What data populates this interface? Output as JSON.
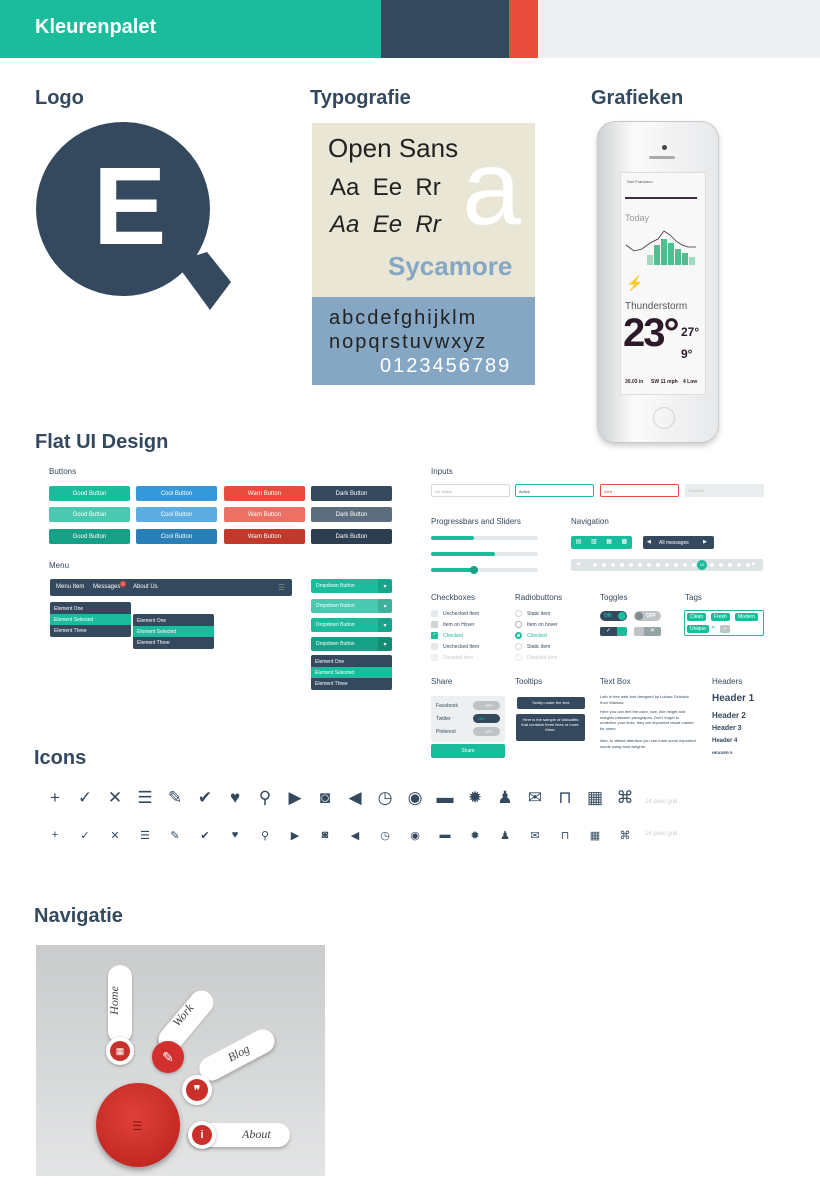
{
  "header": {
    "title": "Kleurenpalet",
    "colors": [
      "#1abc9c",
      "#34495e",
      "#e74c3c",
      "#ecf0f1"
    ]
  },
  "sections": {
    "logo": "Logo",
    "typografie": "Typografie",
    "grafieken": "Grafieken",
    "flat_ui": "Flat UI Design",
    "icons": "Icons",
    "navigatie": "Navigatie"
  },
  "logo": {
    "letter": "E"
  },
  "typography": {
    "font_name": "Open Sans",
    "sample_regular": "Aa  Ee  Rr",
    "sample_italic": "Aa  Ee  Rr",
    "big_letter": "a",
    "secondary_font": "Sycamore",
    "alphabet_1": "abcdefghijklm",
    "alphabet_2": "nopqrstuvwxyz",
    "digits": "0123456789"
  },
  "phone": {
    "location": "San Francisco",
    "today": "Today",
    "condition": "Thunderstorm",
    "temp": "23°",
    "high": "27°",
    "low": "9°",
    "pressure": "30.03 in",
    "wind": "SW 11 mph",
    "uv": "4 Low"
  },
  "flat_ui": {
    "buttons_title": "Buttons",
    "button_labels": [
      "Good Button",
      "Cool Button",
      "Warn Button",
      "Dark Button"
    ],
    "menu_title": "Menu",
    "menu_items": [
      "Menu Item",
      "Messages",
      "About Us"
    ],
    "menu_badge": "1",
    "submenu_1": [
      "Element One",
      "Element Selected",
      "Element Three"
    ],
    "submenu_2": [
      "Element One",
      "Element Selected",
      "Element Three"
    ],
    "dropdown_label": "Dropdown Button",
    "dropdown_items": [
      "Element One",
      "Element Selected",
      "Element Three"
    ],
    "inputs_title": "Inputs",
    "inputs": [
      "UX Active",
      "Active",
      "Alert",
      "Disabled"
    ],
    "progress_title": "Progressbars and Sliders",
    "navigation_title": "Navigation",
    "nav_all_messages": "All messages",
    "pagination_current": "10",
    "checkboxes_title": "Checkboxes",
    "checkboxes": [
      "Unchecked Item",
      "Item on Hover",
      "Checked",
      "Unchecked Item",
      "Disabled item"
    ],
    "radio_title": "Radiobuttons",
    "radios": [
      "Static item",
      "Item on hover",
      "Checked",
      "Static item",
      "Disabled item"
    ],
    "toggles_title": "Toggles",
    "toggle_on": "ON",
    "toggle_off": "OFF",
    "tags_title": "Tags",
    "tags": [
      "Clean",
      "Fresh",
      "Modern",
      "Unique"
    ],
    "share_title": "Share",
    "share_items": [
      "Facebook",
      "Twitter",
      "Pinterest"
    ],
    "share_button": "Share",
    "tooltips_title": "Tooltips",
    "tooltip_1": "Tooltip under the text.",
    "tooltip_2": "Here is the sample of tallouditts that contains three lines or more. More.",
    "textbox_title": "Text Box",
    "textbox_p1": "Lato is free web-font designed by Lukasz Dziedzic from Warsaw.",
    "textbox_p2": "Here you can feel the color, size, line height and margins between paragraphs. Don't forget to underline your links, they are important visual marker for users.",
    "textbox_p3": "Also, to attract attention you can mark some important words using bold weights.",
    "headers_title": "Headers",
    "headers": [
      "Header 1",
      "Header 2",
      "Header 3",
      "Header 4",
      "HEADER 5"
    ]
  },
  "icons": {
    "grid_24": "24 pixel grid",
    "grid_16": "16 pixel grid",
    "names": [
      "plus-icon",
      "check-icon",
      "close-icon",
      "list-icon",
      "edit-icon",
      "check-circle-icon",
      "heart-icon",
      "location-icon",
      "video-icon",
      "camera-icon",
      "volume-icon",
      "clock-icon",
      "eye-icon",
      "chat-icon",
      "gear-icon",
      "user-icon",
      "mail-icon",
      "lock-icon",
      "calendar-icon",
      "command-icon"
    ],
    "glyphs": [
      "+",
      "✓",
      "✕",
      "☰",
      "✎",
      "✔",
      "♥",
      "⚲",
      "▶",
      "◙",
      "◀",
      "◷",
      "◉",
      "▬",
      "✹",
      "♟",
      "✉",
      "⊓",
      "▦",
      "⌘"
    ]
  },
  "navigatie": {
    "items": [
      "Home",
      "Work",
      "Blog",
      "About"
    ]
  }
}
